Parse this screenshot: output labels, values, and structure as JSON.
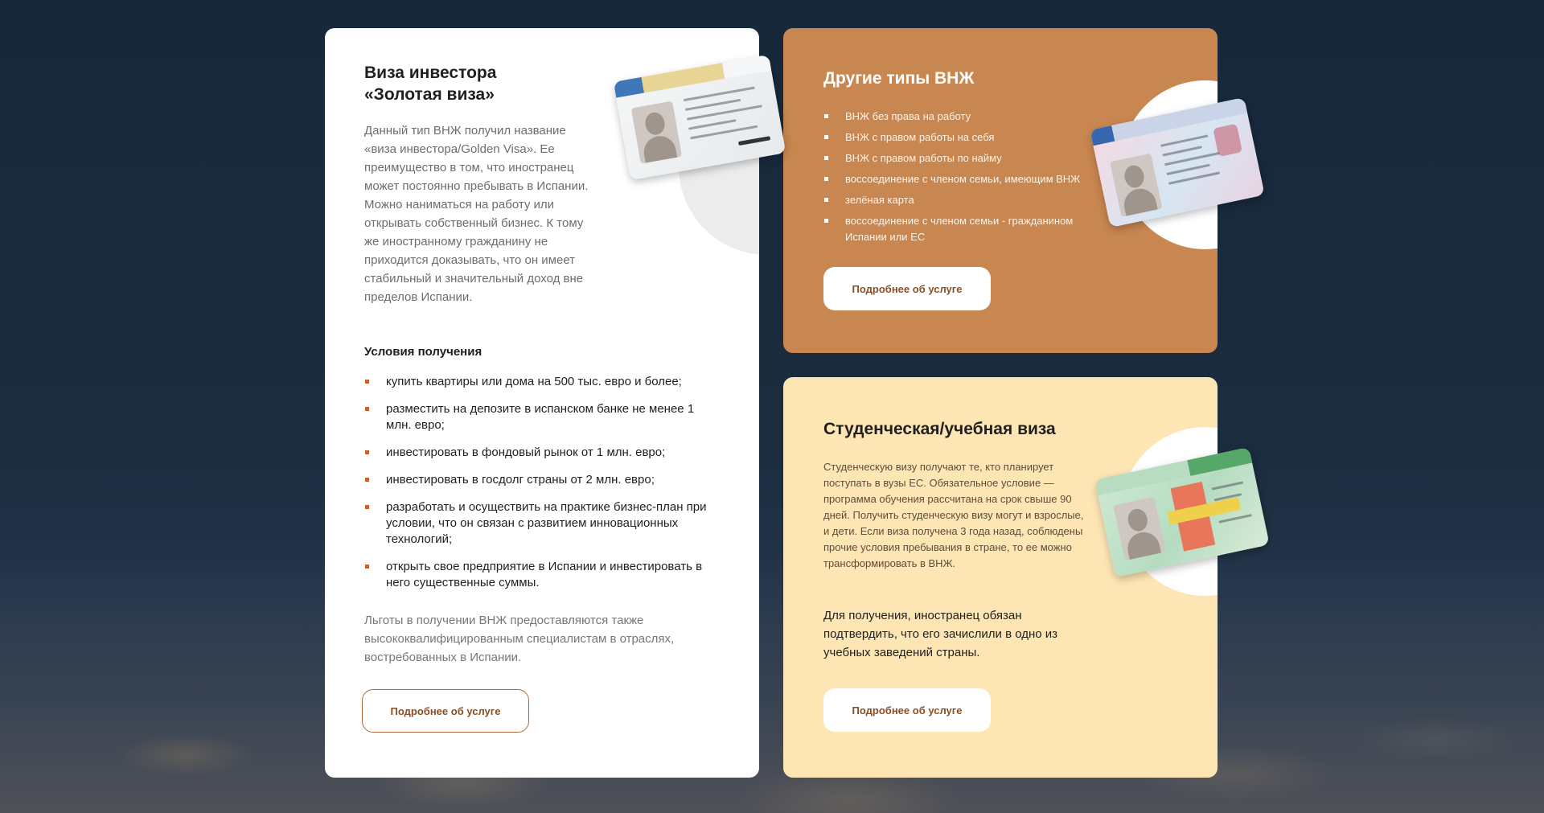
{
  "investor_card": {
    "title_line1": "Виза инвестора",
    "title_line2": "«Золотая виза»",
    "description": "Данный тип ВНЖ получил название «виза инвестора/Golden Visa». Ее преимущество в том, что иностранец может постоянно пребывать в Испании. Можно наниматься на работу или открывать собственный бизнес. К тому же иностранному гражданину не приходится доказывать, что он имеет стабильный и значительный доход вне пределов Испании.",
    "conditions_title": "Условия получения",
    "conditions": [
      "купить квартиры или дома на 500 тыс. евро и более;",
      "разместить на депозите в испанском банке не менее 1 млн. евро;",
      "инвестировать в фондовый рынок от 1 млн. евро;",
      "инвестировать в госдолг страны от 2 млн. евро;",
      "разработать и осуществить на практике бизнес-план при условии, что он связан с развитием инновационных технологий;",
      "открыть свое предприятие в Испании и инвестировать в него существенные суммы."
    ],
    "note": "Льготы в получении ВНЖ предоставляются также высококвалифицированным специалистам в отраслях, востребованных в Испании.",
    "button_label": "Подробнее об услуге",
    "image_icon": "residence-permit-card"
  },
  "other_types_card": {
    "title": "Другие типы  ВНЖ",
    "items": [
      "ВНЖ без права на работу",
      "ВНЖ с правом работы на себя",
      "ВНЖ с правом работы по найму",
      "воссоединение с членом семьи, имеющим ВНЖ",
      "зелёная карта",
      "воссоединение с членом семьи - гражданином Испании или ЕС"
    ],
    "button_label": "Подробнее об услуге",
    "image_icon": "permiso-de-residencia-card"
  },
  "student_card": {
    "title": "Студенческая/учебная виза",
    "description": "Студенческую визу получают те, кто планирует поступать в вузы ЕС. Обязательное условие — программа обучения рассчитана на срок свыше 90 дней. Получить студенческую визу могут и взрослые, и дети. Если виза получена 3 года назад, соблюдены прочие условия пребывания в стране, то ее можно трансформировать в ВНЖ.",
    "note": "Для получения, иностранец обязан подтвердить, что его зачислили в одно из учебных заведений страны.",
    "button_label": "Подробнее об услуге",
    "image_icon": "estudiante-card"
  },
  "colors": {
    "background": "#16283a",
    "white_card": "#ffffff",
    "orange_card": "#c88650",
    "beige_card": "#fde6b4",
    "accent": "#c0642e",
    "button_text": "#8a4e25"
  }
}
